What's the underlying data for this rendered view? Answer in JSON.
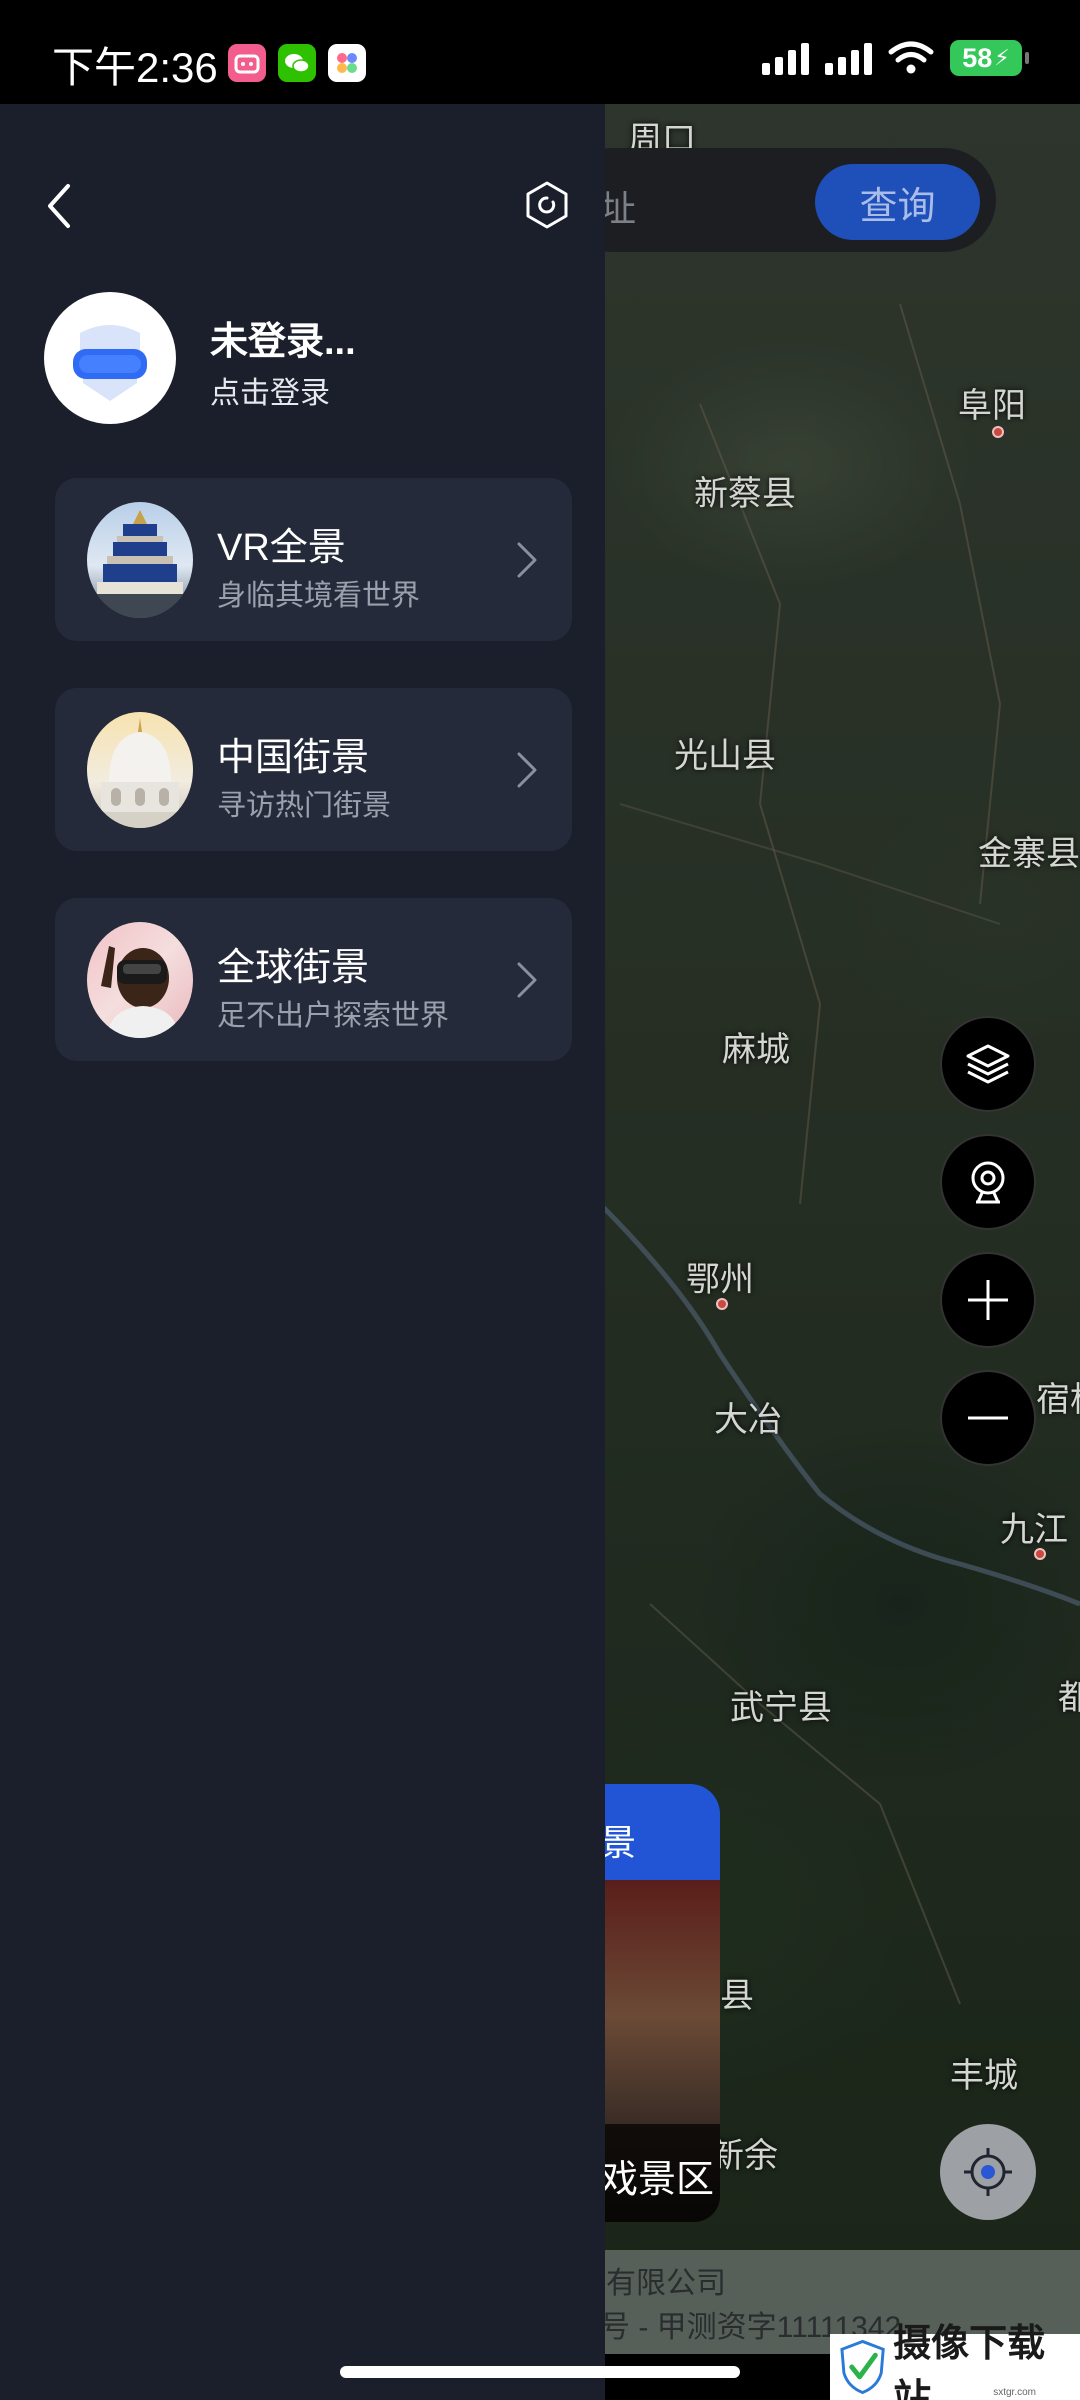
{
  "status_bar": {
    "time": "下午2:36",
    "battery": "58",
    "apps": [
      "bilibili-icon",
      "wechat-icon",
      "app-icon"
    ]
  },
  "map": {
    "search_placeholder": "址",
    "query_label": "查询",
    "labels": [
      "周口",
      "阜阳",
      "新蔡县",
      "光山县",
      "金寨县",
      "麻城",
      "鄂州",
      "大冶",
      "宿松",
      "九江",
      "武宁县",
      "都昌",
      "县",
      "丰城",
      "新余"
    ],
    "scenic_tab_text": "景",
    "scenic_caption": "戏景区",
    "copyright_line1": "有限公司",
    "copyright_line2": "号 - 甲测资字11111342",
    "colors": {
      "query_button": "#1f4fb8",
      "scenic_tab": "#2255d6"
    }
  },
  "drawer": {
    "user_name": "未登录...",
    "login_text": "点击登录",
    "menu": [
      {
        "title": "VR全景",
        "subtitle": "身临其境看世界"
      },
      {
        "title": "中国街景",
        "subtitle": "寻访热门街景"
      },
      {
        "title": "全球街景",
        "subtitle": "足不出户探索世界"
      }
    ],
    "colors": {
      "background": "#1b1f2b",
      "card": "#252a3a"
    }
  },
  "watermark": {
    "text": "摄像下载站",
    "url": "sxtgr.com"
  }
}
